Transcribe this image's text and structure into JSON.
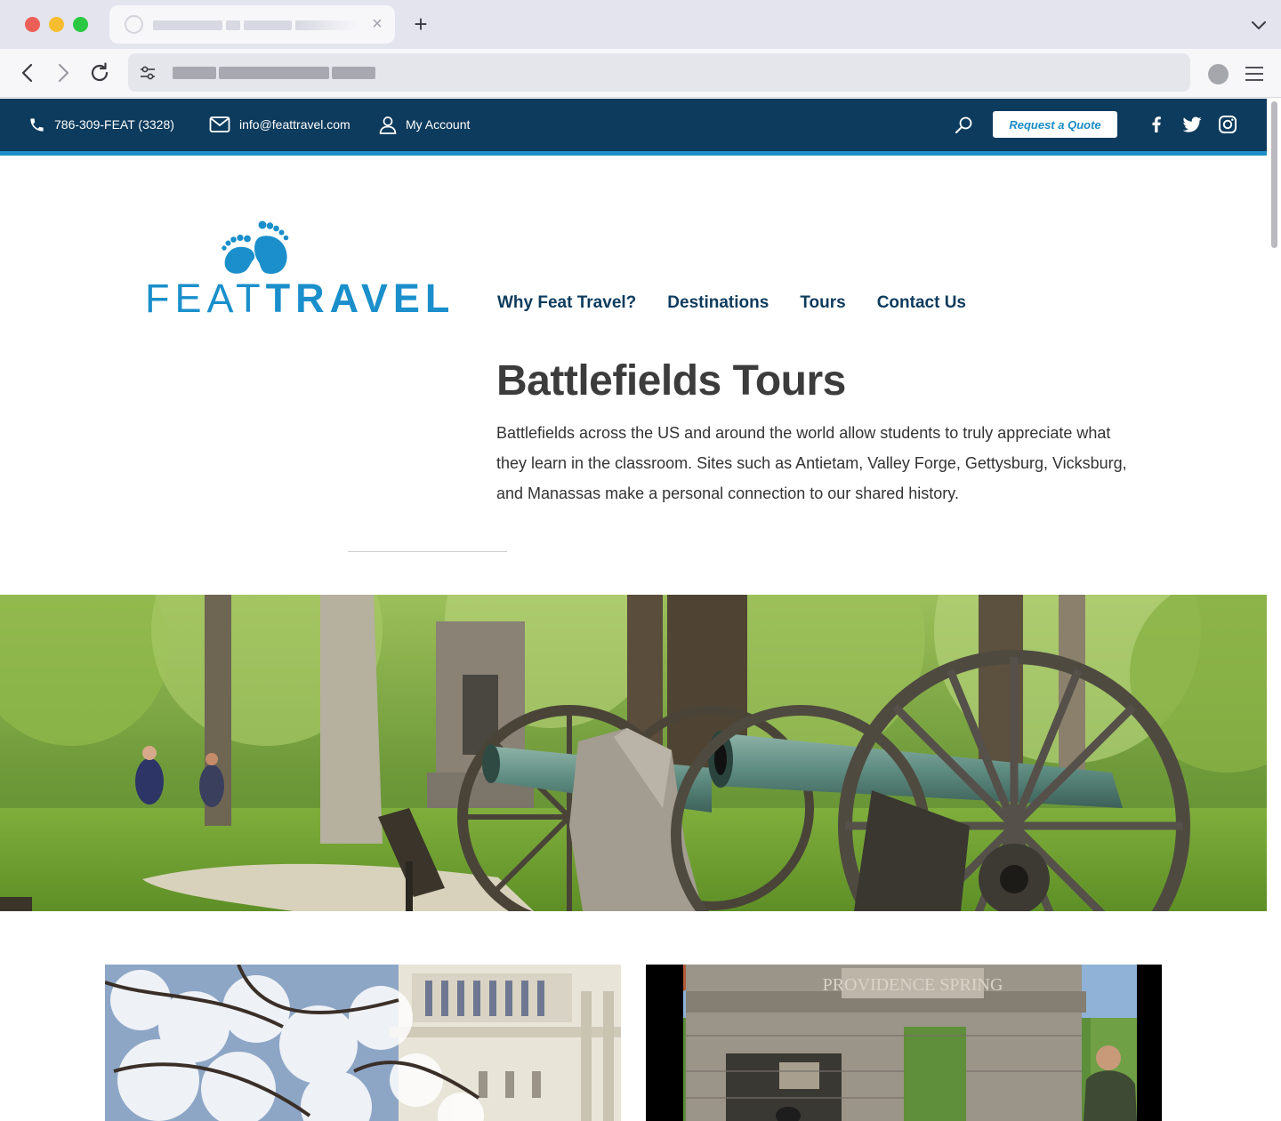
{
  "topbar": {
    "phone": "786-309-FEAT (3328)",
    "email": "info@feattravel.com",
    "account": "My Account",
    "quote_button": "Request a Quote",
    "social": [
      "facebook-icon",
      "twitter-icon",
      "instagram-icon"
    ]
  },
  "logo": {
    "part1": "FEAT",
    "part2": "TRAVEL"
  },
  "nav": {
    "items": [
      {
        "label": "Why Feat Travel?"
      },
      {
        "label": "Destinations"
      },
      {
        "label": "Tours"
      },
      {
        "label": "Contact Us"
      }
    ]
  },
  "hero_section": {
    "title": "Battlefields Tours",
    "intro": "Battlefields across the US and around the world allow students to truly appreciate what they learn in the classroom. Sites such as Antietam, Valley Forge, Gettysburg, Vicksburg, and Manassas make a personal connection to our shared history."
  },
  "cards": {
    "card2_sign": "PROVIDENCE SPRING"
  },
  "colors": {
    "topbar": "#0d3b5d",
    "accent": "#1d8fc6",
    "nav_text": "#0d3b5d",
    "title_text": "#3c3c3c"
  }
}
